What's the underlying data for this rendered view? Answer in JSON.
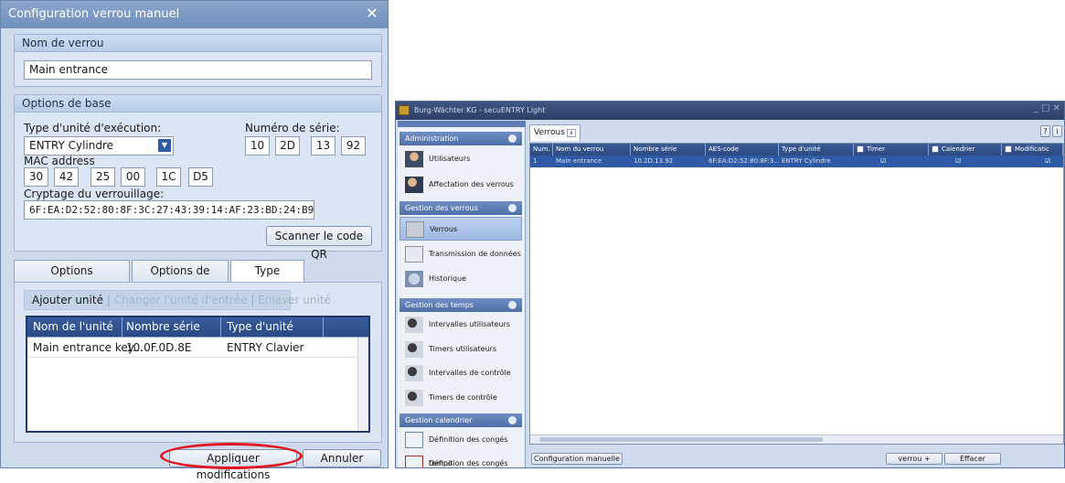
{
  "dialog": {
    "title": "Configuration verrou manuel",
    "close_glyph": "✕",
    "name_section": {
      "header": "Nom de verrou",
      "value": "Main entrance"
    },
    "base_section": {
      "header": "Options de base",
      "unit_type_label": "Type d'unité d'exécution:",
      "unit_type_value": "ENTRY Cylindre",
      "serial_label": "Numéro de série:",
      "serial": [
        "10",
        "2D",
        "13",
        "92"
      ],
      "mac_label": "MAC address",
      "mac": [
        "30",
        "42",
        "25",
        "00",
        "1C",
        "D5"
      ],
      "crypt_label": "Cryptage du verrouillage:",
      "crypt_value": "6F:EA:D2:52:80:8F:3C:27:43:39:14:AF:23:BD:24:B9",
      "scan_button": "Scanner le code QR"
    },
    "tabs": [
      "Options additionnelles",
      "Options de réglage",
      "Type d'entrée"
    ],
    "active_tab": "Type d'entrée",
    "toolbar": {
      "add": "Ajouter unité",
      "change": "Changer l'unité d'entrée",
      "remove": "Enlever unité"
    },
    "table": {
      "headers": [
        "Nom de l'unité",
        "Nombre série",
        "Type d'unité"
      ],
      "rows": [
        [
          "Main entrance key...",
          "10.0F.0D.8E",
          "ENTRY Clavier"
        ]
      ]
    },
    "apply_button": "Appliquer modifications",
    "cancel_button": "Annuler",
    "highlight_color": "#e0141e"
  },
  "app": {
    "title": "Burg-Wächter KG - secuENTRY Light",
    "tab": "Verrous",
    "help_buttons": [
      "?",
      "i"
    ],
    "nav": {
      "groups": [
        {
          "title": "Administration",
          "items": [
            "Utilisateurs",
            "Affectation des verrous"
          ]
        },
        {
          "title": "Gestion des verrous",
          "items": [
            "Verrous",
            "Transmission de données",
            "Historique"
          ]
        },
        {
          "title": "Gestion des temps",
          "items": [
            "Intervalles utilisateurs",
            "Timers utilisateurs",
            "Intervalles de contrôle",
            "Timers de contrôle"
          ]
        },
        {
          "title": "Gestion calendrier",
          "items": [
            "Définition des congés tempo",
            "Définition des congés perma"
          ]
        }
      ],
      "selected": "Verrous"
    },
    "grid": {
      "headers": [
        "Num.",
        "Nom du verrou",
        "Nombre série",
        "AES-code",
        "Type d'unité",
        "Timer",
        "Calendrier",
        "Modificatic"
      ],
      "rows": [
        [
          "1",
          "Main entrance",
          "10.2D.13.92",
          "6F:EA:D2:52:80:8F:3...",
          "ENTRY Cylindre",
          "☑",
          "☑",
          "☑"
        ]
      ]
    },
    "bottom": {
      "manual_config": "Configuration manuelle",
      "add_lock": "verrou +",
      "delete": "Effacer"
    }
  }
}
